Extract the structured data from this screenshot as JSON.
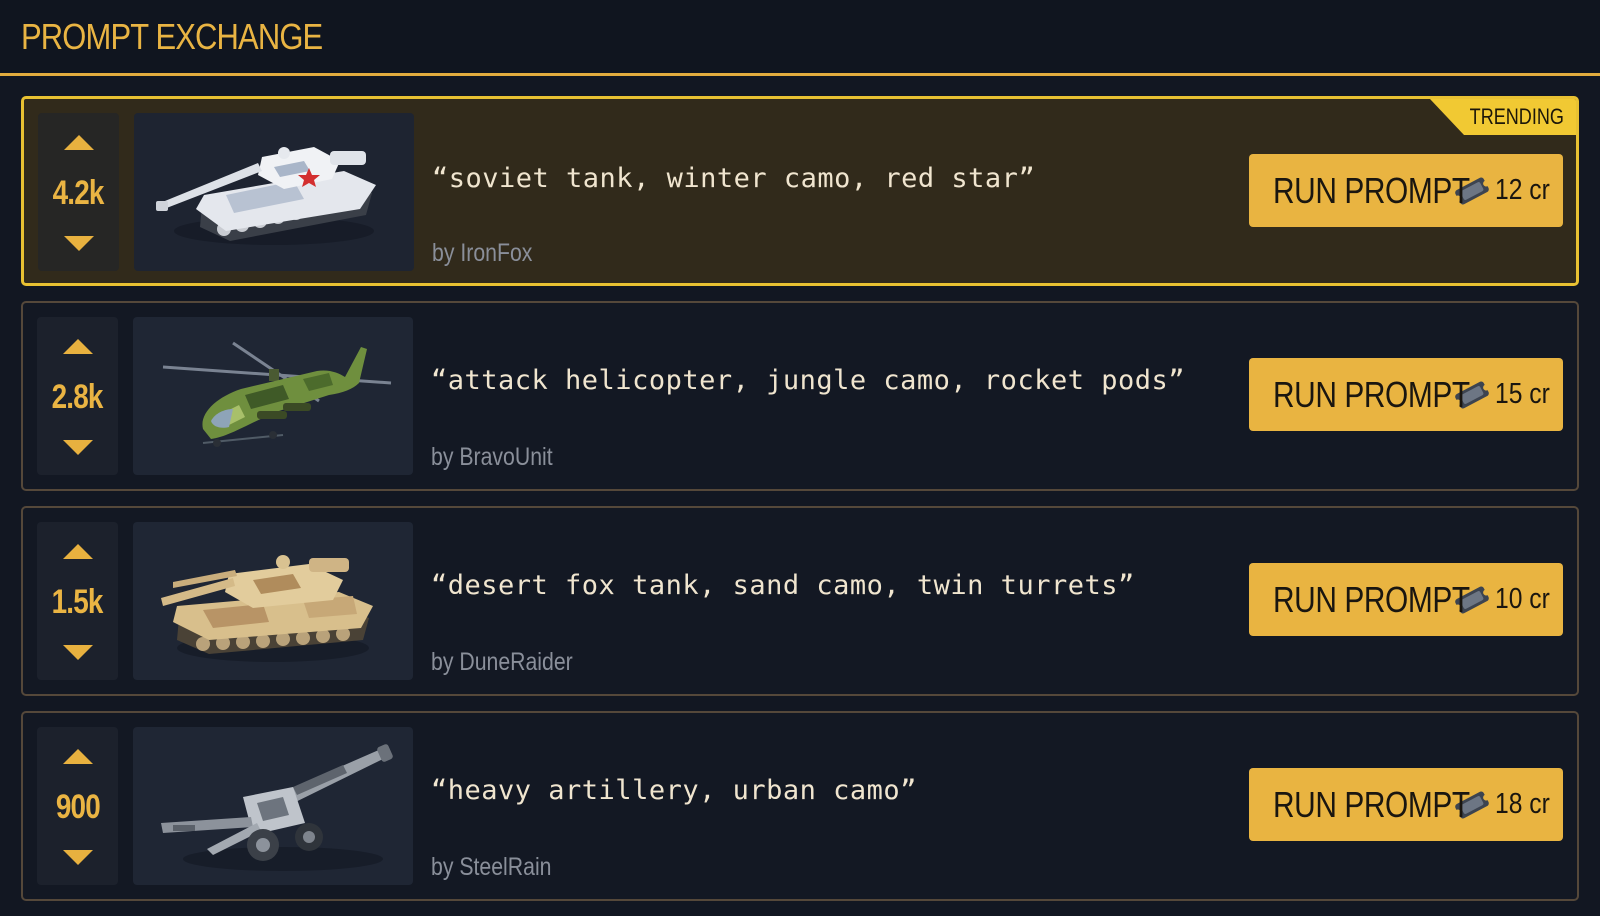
{
  "header": {
    "title": "PROMPT EXCHANGE"
  },
  "colors": {
    "accent": "#e9b441",
    "trending_border": "#e8c132",
    "background": "#121722"
  },
  "cards": [
    {
      "votes": "4.2k",
      "thumbnail": "soviet-tank-winter-icon",
      "prompt": "“soviet tank, winter camo, red star”",
      "author": "by IronFox",
      "run_label": "RUN PROMPT",
      "cost": "12 cr",
      "badge": "TRENDING"
    },
    {
      "votes": "2.8k",
      "thumbnail": "attack-helicopter-jungle-icon",
      "prompt": "“attack helicopter, jungle camo, rocket pods”",
      "author": "by BravoUnit",
      "run_label": "RUN PROMPT",
      "cost": "15 cr"
    },
    {
      "votes": "1.5k",
      "thumbnail": "desert-tank-sand-icon",
      "prompt": "“desert fox tank, sand camo, twin turrets”",
      "author": "by DuneRaider",
      "run_label": "RUN PROMPT",
      "cost": "10 cr"
    },
    {
      "votes": "900",
      "thumbnail": "artillery-urban-icon",
      "prompt": "“heavy artillery, urban camo”",
      "author": "by SteelRain",
      "run_label": "RUN PROMPT",
      "cost": "18 cr"
    }
  ]
}
